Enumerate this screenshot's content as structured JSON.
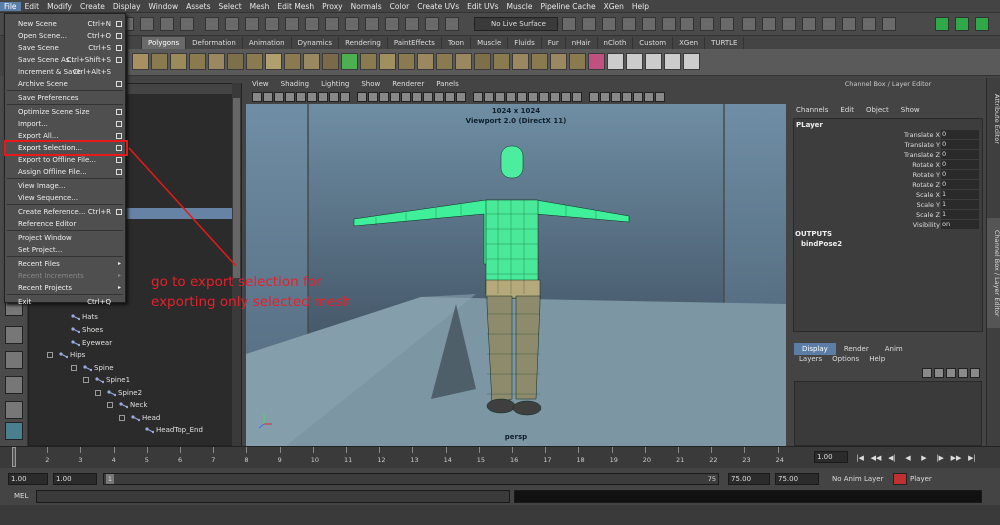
{
  "menubar": [
    "File",
    "Edit",
    "Modify",
    "Create",
    "Display",
    "Window",
    "Assets",
    "Select",
    "Mesh",
    "Edit Mesh",
    "Proxy",
    "Normals",
    "Color",
    "Create UVs",
    "Edit UVs",
    "Muscle",
    "Pipeline Cache",
    "XGen",
    "Help"
  ],
  "statusline": {
    "live_surface": "No Live Surface"
  },
  "shelf_tabs": [
    "Polygons",
    "Deformation",
    "Animation",
    "Dynamics",
    "Rendering",
    "PaintEffects",
    "Toon",
    "Muscle",
    "Fluids",
    "Fur",
    "nHair",
    "nCloth",
    "Custom",
    "XGen",
    "TURTLE"
  ],
  "file_menu": [
    {
      "label": "New Scene",
      "shortcut": "Ctrl+N",
      "option": true
    },
    {
      "label": "Open Scene...",
      "shortcut": "Ctrl+O",
      "option": true
    },
    {
      "label": "Save Scene",
      "shortcut": "Ctrl+S",
      "option": true
    },
    {
      "label": "Save Scene As...",
      "shortcut": "Ctrl+Shift+S",
      "option": true
    },
    {
      "label": "Increment & Save",
      "shortcut": "Ctrl+Alt+S",
      "option": false
    },
    {
      "label": "Archive Scene",
      "shortcut": "",
      "option": true
    },
    {
      "label": "Save Preferences",
      "shortcut": "",
      "option": false
    },
    {
      "label": "Optimize Scene Size",
      "shortcut": "",
      "option": true
    },
    {
      "label": "Import...",
      "shortcut": "",
      "option": true
    },
    {
      "label": "Export All...",
      "shortcut": "",
      "option": true
    },
    {
      "label": "Export Selection...",
      "shortcut": "",
      "option": true
    },
    {
      "label": "Export to Offline File...",
      "shortcut": "",
      "option": true
    },
    {
      "label": "Assign Offline File...",
      "shortcut": "",
      "option": true
    },
    {
      "label": "View Image...",
      "shortcut": "",
      "option": false
    },
    {
      "label": "View Sequence...",
      "shortcut": "",
      "option": false
    },
    {
      "label": "Create Reference...",
      "shortcut": "Ctrl+R",
      "option": true
    },
    {
      "label": "Reference Editor",
      "shortcut": "",
      "option": false
    },
    {
      "label": "Project Window",
      "shortcut": "",
      "option": false
    },
    {
      "label": "Set Project...",
      "shortcut": "",
      "option": false
    },
    {
      "label": "Recent Files",
      "shortcut": "",
      "option": false,
      "submenu": true
    },
    {
      "label": "Recent Increments",
      "shortcut": "",
      "option": false,
      "submenu": true,
      "disabled": true
    },
    {
      "label": "Recent Projects",
      "shortcut": "",
      "option": false,
      "submenu": true
    },
    {
      "label": "Exit",
      "shortcut": "Ctrl+Q",
      "option": false
    }
  ],
  "annotation": {
    "line1": "go to export selection for",
    "line2": "exporting only selected mesh"
  },
  "outliner": [
    "Hats",
    "Shoes",
    "Eyewear",
    "Hips",
    "Spine",
    "Spine1",
    "Spine2",
    "Neck",
    "Head",
    "HeadTop_End"
  ],
  "viewport": {
    "menu": [
      "View",
      "Shading",
      "Lighting",
      "Show",
      "Renderer",
      "Panels"
    ],
    "resolution": "1024 x 1024",
    "renderer": "Viewport 2.0 (DirectX 11)",
    "camera": "persp"
  },
  "channel_box": {
    "title": "Channel Box / Layer Editor",
    "menu": [
      "Channels",
      "Edit",
      "Object",
      "Show"
    ],
    "object": "PLayer",
    "attributes": [
      {
        "name": "Translate X",
        "value": "0"
      },
      {
        "name": "Translate Y",
        "value": "0"
      },
      {
        "name": "Translate Z",
        "value": "0"
      },
      {
        "name": "Rotate X",
        "value": "0"
      },
      {
        "name": "Rotate Y",
        "value": "0"
      },
      {
        "name": "Rotate Z",
        "value": "0"
      },
      {
        "name": "Scale X",
        "value": "1"
      },
      {
        "name": "Scale Y",
        "value": "1"
      },
      {
        "name": "Scale Z",
        "value": "1"
      },
      {
        "name": "Visibility",
        "value": "on"
      }
    ],
    "outputs_label": "OUTPUTS",
    "output_node": "bindPose2"
  },
  "layer_editor": {
    "tabs": [
      "Display",
      "Render",
      "Anim"
    ],
    "menu": [
      "Layers",
      "Options",
      "Help"
    ]
  },
  "side_tabs": [
    "Attribute Editor",
    "Channel Box / Layer Editor"
  ],
  "timeline": {
    "ticks": [
      "1",
      "2",
      "3",
      "4",
      "5",
      "6",
      "7",
      "8",
      "9",
      "10",
      "11",
      "12",
      "13",
      "14",
      "15",
      "16",
      "17",
      "18",
      "19",
      "20",
      "21",
      "22",
      "23",
      "24"
    ],
    "current": "1.00"
  },
  "range": {
    "start": "1.00",
    "start2": "1.00",
    "marker": "1",
    "range_end": "75",
    "end": "75.00",
    "end2": "75.00",
    "anim_layer": "No Anim Layer",
    "character": "Player"
  },
  "command": {
    "label": "MEL"
  }
}
